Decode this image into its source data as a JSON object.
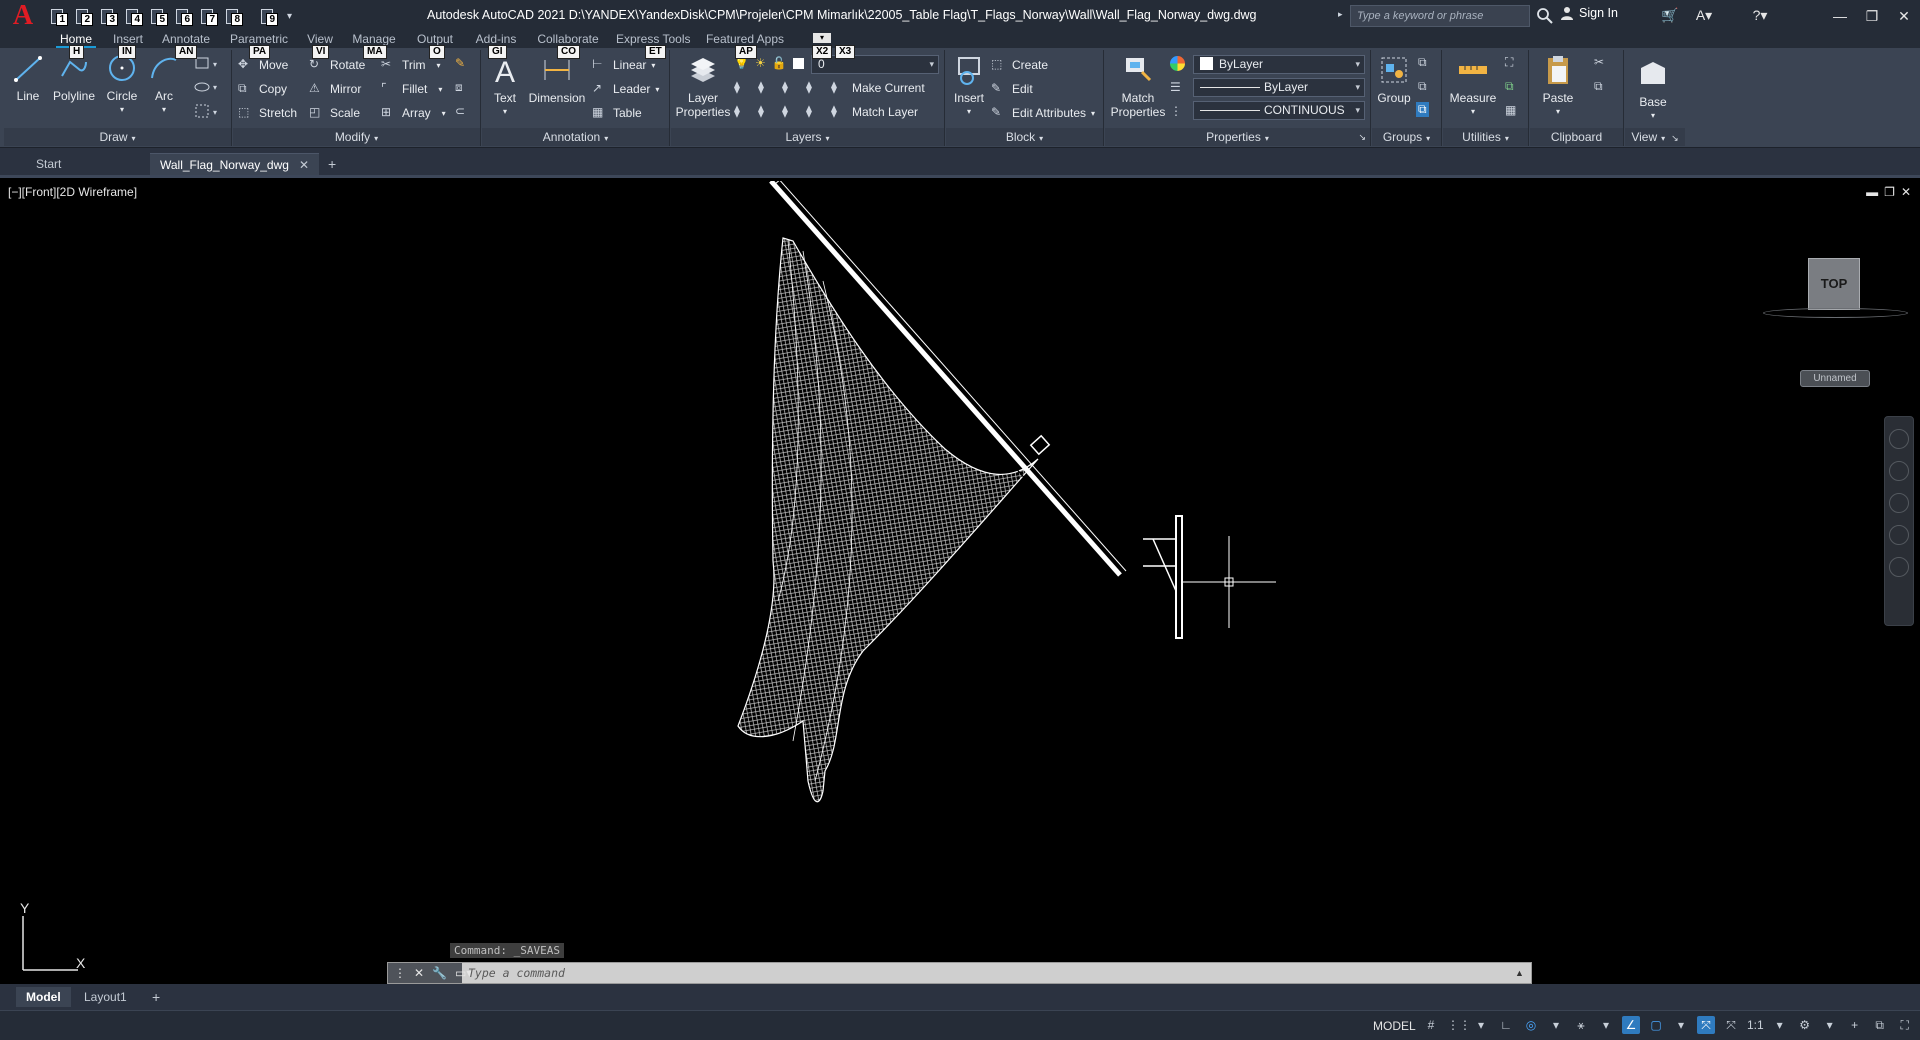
{
  "app": {
    "title": "Autodesk AutoCAD 2021    D:\\YANDEX\\YandexDisk\\CPM\\Projeler\\CPM Mimarlık\\22005_Table Flag\\T_Flags_Norway\\Wall\\Wall_Flag_Norway_dwg.dwg",
    "logo_letter": "A",
    "search_placeholder": "Type a keyword or phrase",
    "sign_in": "Sign In"
  },
  "qat_keytips": [
    "1",
    "2",
    "3",
    "4",
    "5",
    "6",
    "7",
    "8",
    "9"
  ],
  "ribbon_tabs": [
    {
      "label": "Home",
      "keytip": "H",
      "active": true
    },
    {
      "label": "Insert",
      "keytip": "IN"
    },
    {
      "label": "Annotate",
      "keytip": "AN"
    },
    {
      "label": "Parametric",
      "keytip": "PA"
    },
    {
      "label": "View",
      "keytip": "VI"
    },
    {
      "label": "Manage",
      "keytip": "MA"
    },
    {
      "label": "Output",
      "keytip": "O"
    },
    {
      "label": "Add-ins",
      "keytip": "GI"
    },
    {
      "label": "Collaborate",
      "keytip": "CO"
    },
    {
      "label": "Express Tools",
      "keytip": "ET"
    },
    {
      "label": "Featured Apps",
      "keytip": "AP"
    }
  ],
  "extra_keytips": [
    "X2",
    "X3"
  ],
  "panels": {
    "draw": {
      "title": "Draw",
      "line": "Line",
      "polyline": "Polyline",
      "circle": "Circle",
      "arc": "Arc"
    },
    "modify": {
      "title": "Modify",
      "move": "Move",
      "rotate": "Rotate",
      "trim": "Trim",
      "copy": "Copy",
      "mirror": "Mirror",
      "fillet": "Fillet",
      "stretch": "Stretch",
      "scale": "Scale",
      "array": "Array"
    },
    "annotation": {
      "title": "Annotation",
      "text": "Text",
      "dimension": "Dimension",
      "linear": "Linear",
      "leader": "Leader",
      "table": "Table"
    },
    "layers": {
      "title": "Layers",
      "layer_properties": "Layer Properties",
      "layer_name": "0",
      "make_current": "Make Current",
      "match_layer": "Match Layer"
    },
    "block": {
      "title": "Block",
      "insert": "Insert",
      "create": "Create",
      "edit": "Edit",
      "edit_attributes": "Edit Attributes"
    },
    "properties": {
      "title": "Properties",
      "match_properties": "Match Properties",
      "color": "ByLayer",
      "lineweight": "ByLayer",
      "linetype": "CONTINUOUS"
    },
    "groups": {
      "title": "Groups",
      "group": "Group"
    },
    "utilities": {
      "title": "Utilities",
      "measure": "Measure"
    },
    "clipboard": {
      "title": "Clipboard",
      "paste": "Paste"
    },
    "view": {
      "title": "View",
      "base": "Base"
    }
  },
  "file_tabs": [
    {
      "label": "Start"
    },
    {
      "label": "Wall_Flag_Norway_dwg",
      "active": true
    }
  ],
  "viewport": {
    "label": "[−][Front][2D Wireframe]",
    "viewcube_face": "TOP",
    "wcs": "Unnamed",
    "ucs_y": "Y",
    "ucs_x": "X"
  },
  "command": {
    "history": "Command: _SAVEAS",
    "placeholder": "Type a command"
  },
  "layout_tabs": [
    {
      "label": "Model",
      "active": true
    },
    {
      "label": "Layout1"
    }
  ],
  "status": {
    "model": "MODEL",
    "scale": "1:1"
  },
  "colors": {
    "accent": "#1a9bd7",
    "ribbon_bg": "#3b4453",
    "title_bg": "#252c37",
    "canvas": "#000000",
    "logo": "#e01c24"
  }
}
